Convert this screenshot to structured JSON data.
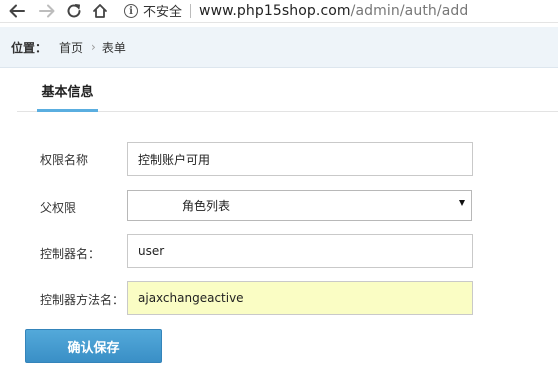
{
  "browser": {
    "security_label": "不安全",
    "url_domain": "www.php15shop.com",
    "url_path": "/admin/auth/add"
  },
  "location": {
    "label": "位置：",
    "home": "首页",
    "separator": "›",
    "current": "表单"
  },
  "tabs": {
    "active_label": "基本信息",
    "accent_color": "#5aaee0"
  },
  "form": {
    "permission_name": {
      "label": "权限名称",
      "value": "控制账户可用"
    },
    "parent_permission": {
      "label": "父权限",
      "selected": "角色列表"
    },
    "controller_name": {
      "label": "控制器名：",
      "value": "user"
    },
    "controller_method": {
      "label": "控制器方法名：",
      "value": "ajaxchangeactive",
      "autofill_color": "#fafdc4"
    },
    "save_label": "确认保存",
    "save_color": "#3a8fc6"
  },
  "icons": [
    "back-arrow-icon",
    "forward-arrow-icon",
    "reload-icon",
    "home-icon",
    "info-icon",
    "chevron-down-icon"
  ]
}
